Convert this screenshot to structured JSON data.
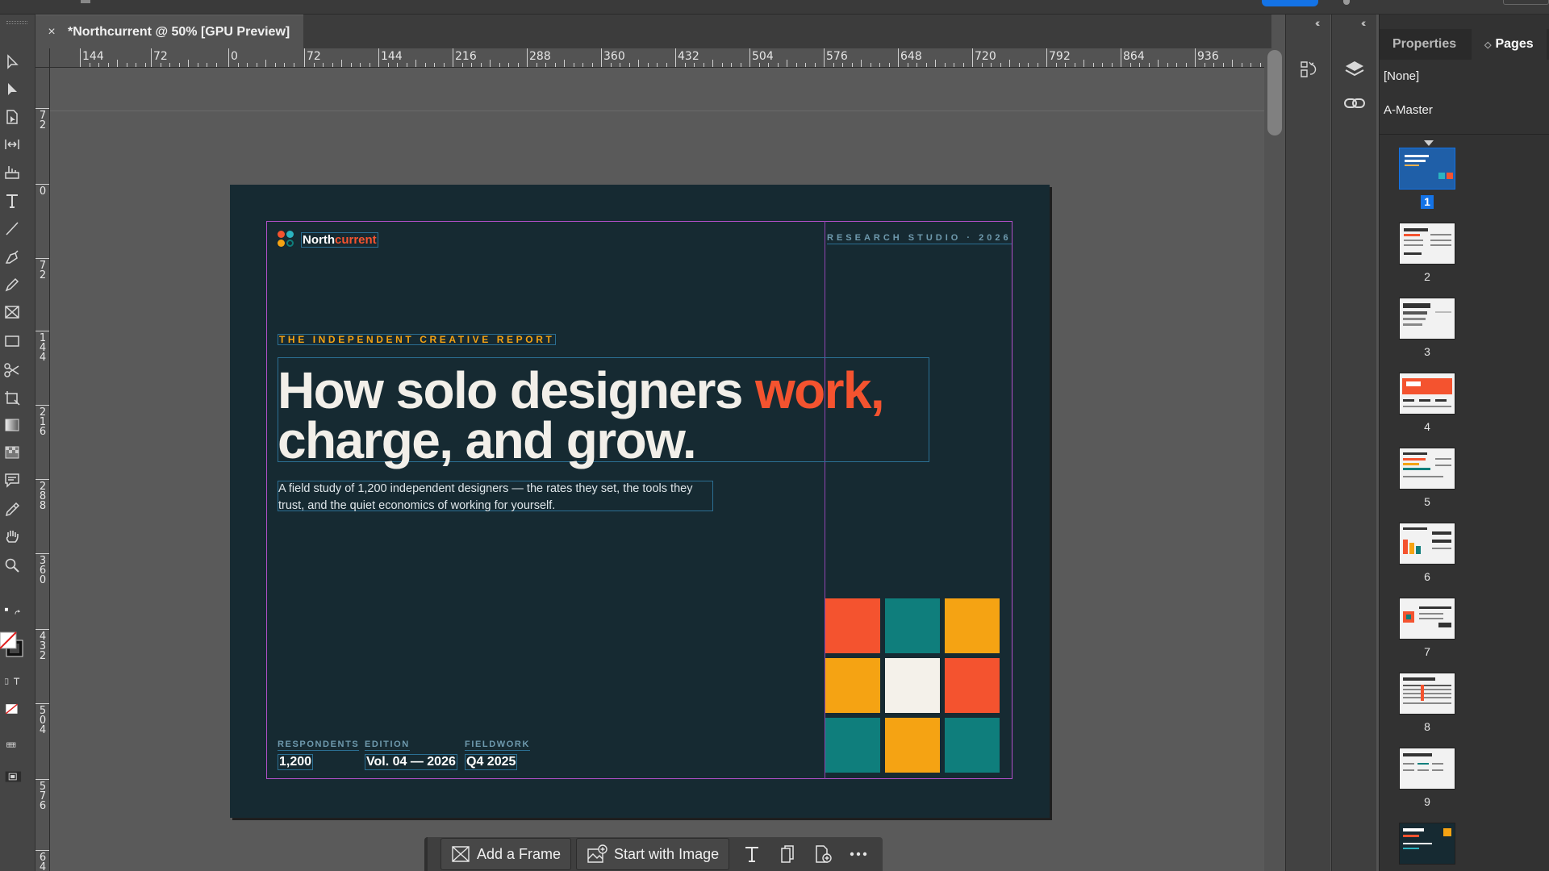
{
  "app": {
    "document_tab": "*Northcurrent @ 50% [GPU Preview]",
    "tab_close_glyph": "×"
  },
  "ruler": {
    "horizontal": [
      "144",
      "72",
      "0",
      "72",
      "144",
      "216",
      "288",
      "360",
      "432",
      "504",
      "576",
      "648",
      "720",
      "792",
      "864",
      "936"
    ],
    "vertical": [
      [
        "7",
        "2"
      ],
      [
        "0"
      ],
      [
        "7",
        "2"
      ],
      [
        "1",
        "4",
        "4"
      ],
      [
        "2",
        "1",
        "6"
      ],
      [
        "2",
        "8",
        "8"
      ],
      [
        "3",
        "6",
        "0"
      ],
      [
        "4",
        "3",
        "2"
      ],
      [
        "5",
        "0",
        "4"
      ],
      [
        "5",
        "7",
        "6"
      ],
      [
        "6",
        "4"
      ]
    ]
  },
  "page": {
    "brand_prefix": "North",
    "brand_accent": "current",
    "studio_line": "RESEARCH STUDIO · 2026",
    "kicker": "THE INDEPENDENT CREATIVE REPORT",
    "headline_part1": "How solo designers ",
    "headline_highlight": "work,",
    "headline_part2": "charge, and grow.",
    "dek": "A field study of 1,200 independent designers — the rates they set, the tools they trust, and the quiet economics of working for yourself.",
    "stats": [
      {
        "label": "RESPONDENTS",
        "value": "1,200"
      },
      {
        "label": "EDITION",
        "value": "Vol. 04 — 2026"
      },
      {
        "label": "FIELDWORK",
        "value": "Q4 2025"
      }
    ],
    "grid_colors": [
      "#f4532f",
      "#0f7e7c",
      "#f5a313",
      "#f5a313",
      "#f4f1ea",
      "#f4532f",
      "#0f7e7c",
      "#f5a313",
      "#0f7e7c"
    ],
    "logo_dot_colors": [
      "#f4532f",
      "#2bb3c0",
      "#f5a313",
      "#0f7e7c"
    ]
  },
  "colors": {
    "page_bg": "#162a32",
    "accent_orange": "#f4532f",
    "accent_amber": "#f5a313",
    "accent_teal": "#0f7e7c",
    "selection_blue": "#1473e6"
  },
  "context_bar": {
    "add_frame": "Add a Frame",
    "start_with_image": "Start with Image"
  },
  "panel": {
    "tabs": [
      "Properties",
      "Pages"
    ],
    "active_tab": "Pages",
    "masters": [
      "[None]",
      "A-Master"
    ],
    "pages": [
      "1",
      "2",
      "3",
      "4",
      "5",
      "6",
      "7",
      "8",
      "9"
    ],
    "selected_page": "1"
  }
}
